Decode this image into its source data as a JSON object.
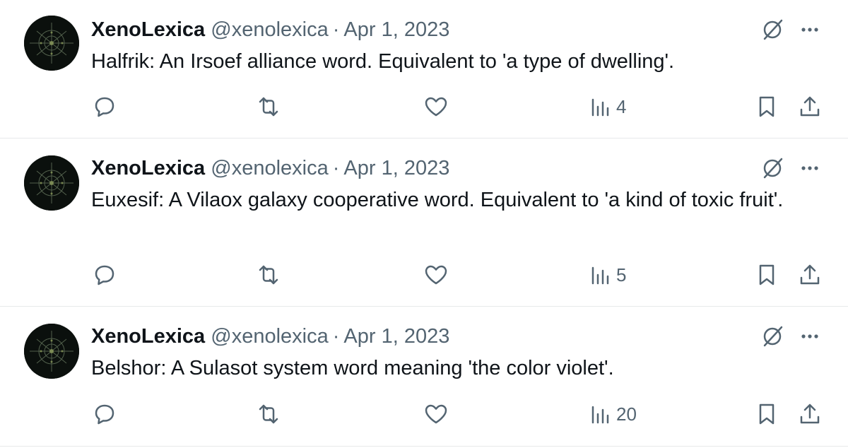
{
  "tweets": [
    {
      "name": "XenoLexica",
      "handle": "@xenolexica",
      "separator": "·",
      "date": "Apr 1, 2023",
      "text": "Halfrik: An Irsoef alliance word. Equivalent to 'a type of dwelling'.",
      "views": "4"
    },
    {
      "name": "XenoLexica",
      "handle": "@xenolexica",
      "separator": "·",
      "date": "Apr 1, 2023",
      "text": "Euxesif: A Vilaox galaxy cooperative word. Equivalent to 'a kind of toxic fruit'.",
      "views": "5"
    },
    {
      "name": "XenoLexica",
      "handle": "@xenolexica",
      "separator": "·",
      "date": "Apr 1, 2023",
      "text": "Belshor: A Sulasot system word meaning 'the color violet'.",
      "views": "20"
    }
  ],
  "icons": {
    "grok": "grok-slash-circle-icon",
    "more": "more-dots-icon",
    "reply": "reply-bubble-icon",
    "retweet": "retweet-arrows-icon",
    "like": "heart-icon",
    "views": "bar-chart-icon",
    "bookmark": "bookmark-icon",
    "share": "share-upload-icon"
  },
  "colors": {
    "text": "#0f1419",
    "secondary": "#536471",
    "divider": "#e7e9ea",
    "background": "#ffffff"
  }
}
